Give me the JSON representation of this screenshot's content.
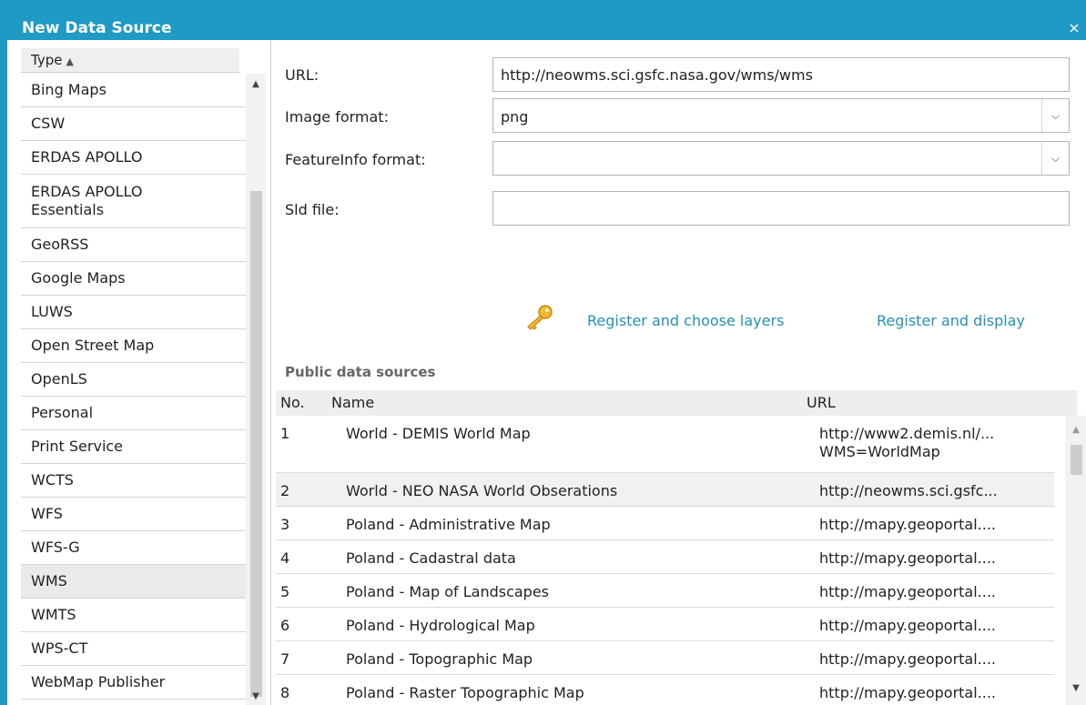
{
  "dialog": {
    "title": "New Data Source",
    "close_glyph": "×"
  },
  "type_list": {
    "header": "Type",
    "sort_glyph": "▲",
    "items": [
      {
        "label": "Bing Maps",
        "lines": 1
      },
      {
        "label": "CSW",
        "lines": 1
      },
      {
        "label": "ERDAS APOLLO",
        "lines": 1
      },
      {
        "label": "ERDAS APOLLO Essentials",
        "lines": 2
      },
      {
        "label": "GeoRSS",
        "lines": 1
      },
      {
        "label": "Google Maps",
        "lines": 1
      },
      {
        "label": "LUWS",
        "lines": 1
      },
      {
        "label": "Open Street Map",
        "lines": 1
      },
      {
        "label": "OpenLS",
        "lines": 1
      },
      {
        "label": "Personal",
        "lines": 1
      },
      {
        "label": "Print Service",
        "lines": 1
      },
      {
        "label": "WCTS",
        "lines": 1
      },
      {
        "label": "WFS",
        "lines": 1
      },
      {
        "label": "WFS-G",
        "lines": 1
      },
      {
        "label": "WMS",
        "lines": 1
      },
      {
        "label": "WMTS",
        "lines": 1
      },
      {
        "label": "WPS-CT",
        "lines": 1
      },
      {
        "label": "WebMap Publisher",
        "lines": 1
      }
    ],
    "selected": "WMS"
  },
  "form": {
    "url_label": "URL:",
    "url_value": "http://neowms.sci.gsfc.nasa.gov/wms/wms",
    "image_format_label": "Image format:",
    "image_format_value": "png",
    "featureinfo_label": "FeatureInfo format:",
    "featureinfo_value": "",
    "sld_label": "Sld file:",
    "sld_value": ""
  },
  "actions": {
    "register_choose": "Register and choose layers",
    "register_display": "Register and display"
  },
  "public_sources": {
    "title": "Public data sources",
    "columns": {
      "no": "No.",
      "name": "Name",
      "url": "URL"
    },
    "rows": [
      {
        "no": "1",
        "name": "World - DEMIS World Map",
        "url": [
          "http://www2.demis.nl/...",
          "WMS=WorldMap"
        ]
      },
      {
        "no": "2",
        "name": "World - NEO NASA World Obserations",
        "url": [
          "http://neowms.sci.gsfc..."
        ]
      },
      {
        "no": "3",
        "name": "Poland - Administrative Map",
        "url": [
          "http://mapy.geoportal...."
        ]
      },
      {
        "no": "4",
        "name": "Poland - Cadastral data",
        "url": [
          "http://mapy.geoportal...."
        ]
      },
      {
        "no": "5",
        "name": "Poland - Map of Landscapes",
        "url": [
          "http://mapy.geoportal...."
        ]
      },
      {
        "no": "6",
        "name": "Poland - Hydrological Map",
        "url": [
          "http://mapy.geoportal...."
        ]
      },
      {
        "no": "7",
        "name": "Poland - Topographic Map",
        "url": [
          "http://mapy.geoportal...."
        ]
      },
      {
        "no": "8",
        "name": "Poland - Raster Topographic Map",
        "url": [
          "http://mapy.geoportal...."
        ]
      }
    ],
    "highlighted_row": "2"
  },
  "icons": {
    "close": "close-icon",
    "sort": "sort-ascending-icon",
    "key": "key-icon",
    "dropdown": "chevron-down-icon"
  },
  "colors": {
    "titlebar": "#1e9ac4",
    "link": "#2490b8",
    "selected_row": "#eaeaea",
    "highlight_row": "#f1f1f1"
  }
}
